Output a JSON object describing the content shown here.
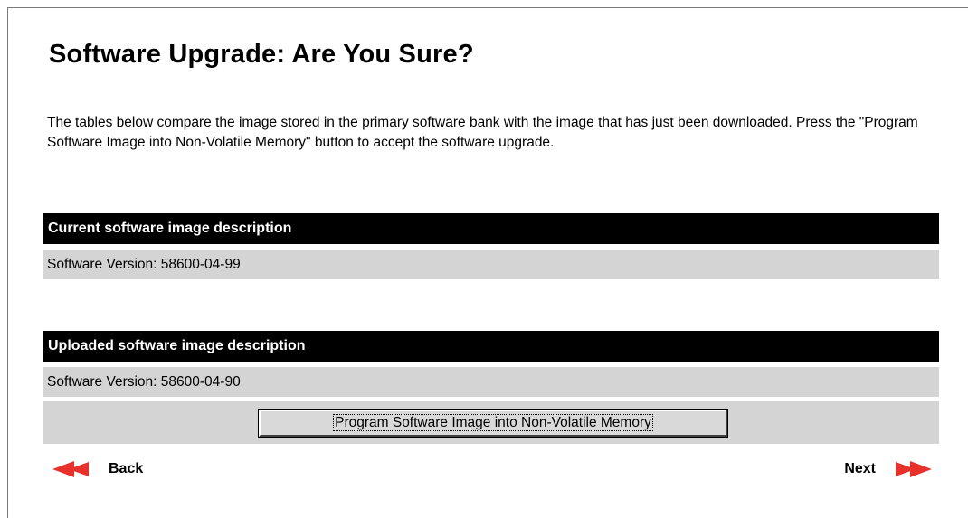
{
  "page": {
    "title": "Software Upgrade: Are You Sure?",
    "intro": "The tables below compare the image stored in the primary software bank with the image that has just been downloaded. Press the \"Program Software Image into Non-Volatile Memory\" button to accept the software upgrade."
  },
  "current": {
    "header": "Current software image description",
    "version": "Software Version: 58600-04-99"
  },
  "uploaded": {
    "header": "Uploaded software image description",
    "version": "Software Version: 58600-04-90"
  },
  "program_button": {
    "label": "Program Software Image into Non-Volatile Memory"
  },
  "nav": {
    "back_label": "Back",
    "next_label": "Next",
    "back_icon": "double-left-arrow-icon",
    "next_icon": "double-right-arrow-icon",
    "arrow_color": "#e8312b"
  },
  "colors": {
    "header_bg": "#000000",
    "header_text": "#ffffff",
    "row_bg": "#d4d4d4"
  }
}
